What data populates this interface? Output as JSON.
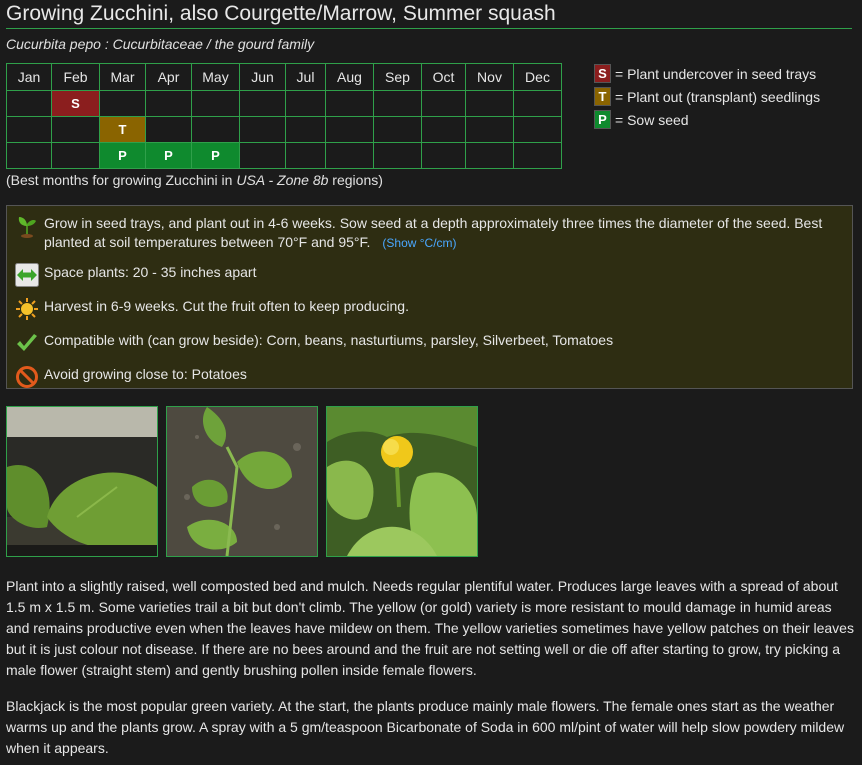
{
  "page": {
    "title": "Growing Zucchini, also Courgette/Marrow, Summer squash",
    "subtitle": "Cucurbita pepo : Cucurbitaceae / the gourd family"
  },
  "calendar": {
    "months": [
      "Jan",
      "Feb",
      "Mar",
      "Apr",
      "May",
      "Jun",
      "Jul",
      "Aug",
      "Sep",
      "Oct",
      "Nov",
      "Dec"
    ],
    "rows": [
      [
        "",
        "S",
        "",
        "",
        "",
        "",
        "",
        "",
        "",
        "",
        "",
        ""
      ],
      [
        "",
        "",
        "T",
        "",
        "",
        "",
        "",
        "",
        "",
        "",
        "",
        ""
      ],
      [
        "",
        "",
        "P",
        "P",
        "P",
        "",
        "",
        "",
        "",
        "",
        "",
        ""
      ]
    ],
    "caption_prefix": "(Best months for growing Zucchini in ",
    "caption_region": "USA - Zone 8b",
    "caption_suffix": " regions)"
  },
  "legend": [
    {
      "code": "S",
      "text": "= Plant undercover in seed trays",
      "color": "#8b1e1e"
    },
    {
      "code": "T",
      "text": "= Plant out (transplant) seedlings",
      "color": "#8a6400"
    },
    {
      "code": "P",
      "text": "= Sow seed",
      "color": "#0f8a2e"
    }
  ],
  "tips": {
    "sow": "Grow in seed trays, and plant out in 4-6 weeks. Sow seed at a depth approximately three times the diameter of the seed. Best planted at soil temperatures between 70°F and 95°F.",
    "show_units_link": "(Show °C/cm)",
    "spacing": "Space plants: 20 - 35 inches apart",
    "harvest": "Harvest in 6-9 weeks. Cut the fruit often to keep producing.",
    "compatible": "Compatible with (can grow beside): Corn, beans, nasturtiums, parsley, Silverbeet, Tomatoes",
    "avoid": "Avoid growing close to: Potatoes"
  },
  "icons": {
    "sow": "seedling-icon",
    "spacing": "double-arrow-icon",
    "harvest": "sun-icon",
    "compatible": "checkmark-icon",
    "avoid": "no-entry-icon"
  },
  "photos": [
    "zucchini-seedling-photo",
    "zucchini-young-plant-photo",
    "zucchini-flower-photo"
  ],
  "paragraphs": [
    "Plant into a slightly raised, well composted bed and mulch. Needs regular plentiful water. Produces large leaves with a spread of about 1.5 m x 1.5 m. Some varieties trail a bit but don't climb. The yellow (or gold) variety is more resistant to mould damage in humid areas and remains productive even when the leaves have mildew on them. The yellow varieties sometimes have yellow patches on their leaves but it is just colour not disease. If there are no bees around and the fruit are not setting well or die off after starting to grow, try picking a male flower (straight stem) and gently brushing pollen inside female flowers.",
    "Blackjack is the most popular green variety. At the start, the plants produce mainly male flowers. The female ones start as the weather warms up and the plants grow. A spray with a 5 gm/teaspoon Bicarbonate of Soda in 600 ml/pint of water will help slow powdery mildew when it appears."
  ]
}
